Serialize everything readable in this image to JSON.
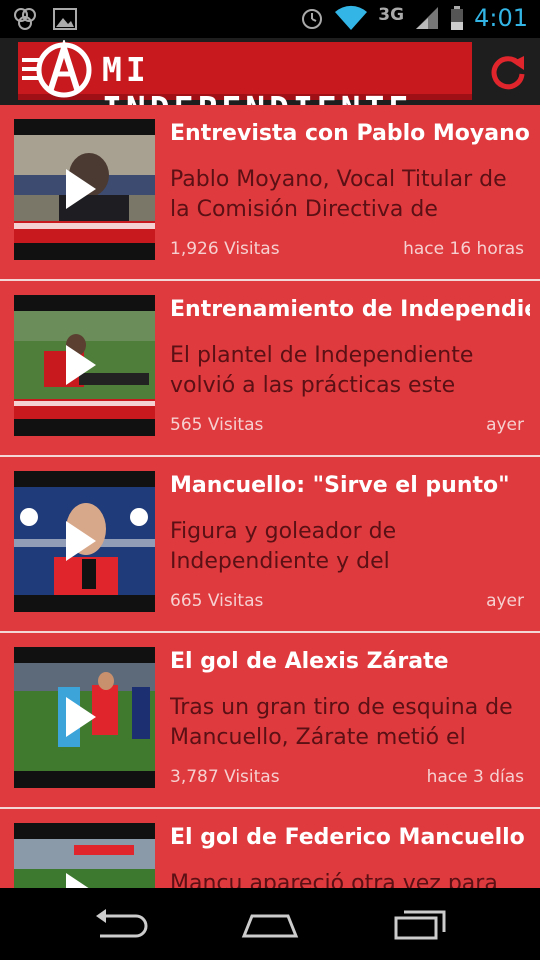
{
  "status_bar": {
    "network": "3G",
    "time": "4:01"
  },
  "header": {
    "title": "MI INDEPENDIENTE"
  },
  "items": [
    {
      "title": "Entrevista con Pablo Moyano",
      "description": "Pablo Moyano, Vocal Titular de la Comisión Directiva de",
      "views": "1,926 Visitas",
      "time": "hace 16 horas"
    },
    {
      "title": "Entrenamiento de Independiente",
      "description": "El plantel de Independiente volvió a las prácticas este",
      "views": "565 Visitas",
      "time": "ayer"
    },
    {
      "title": "Mancuello: \"Sirve el punto\"",
      "description": "Figura y goleador de Independiente y del campeonato,",
      "views": "665 Visitas",
      "time": "ayer"
    },
    {
      "title": "El gol de Alexis Zárate",
      "description": "Tras un gran tiro de esquina de Mancuello, Zárate metió el",
      "views": "3,787 Visitas",
      "time": "hace 3 días"
    },
    {
      "title": "El gol de Federico Mancuello",
      "description": "Mancu apareció otra vez para",
      "views": "",
      "time": ""
    }
  ],
  "colors": {
    "list_bg": "#df3a3e",
    "banner_red": "#c8191f",
    "accent_blue": "#33b5e5"
  }
}
